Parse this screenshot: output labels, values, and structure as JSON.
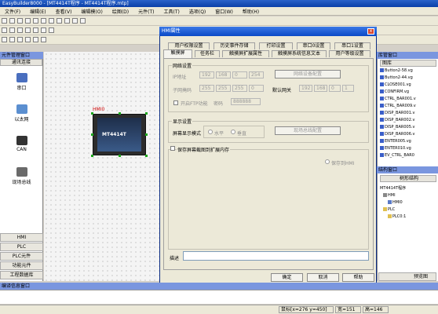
{
  "app": {
    "title": "EasyBuilder8000 - [MT4414T程序 - MT4414T程序.mtp]"
  },
  "menu": [
    "文件(F)",
    "编辑(E)",
    "查看(V)",
    "编辑模(O)",
    "绘图(D)",
    "元件(T)",
    "工具(T)",
    "选项(Q)",
    "窗口(W)",
    "帮助(H)"
  ],
  "left_panel": {
    "title": "元件管理窗口",
    "header": "通讯连接",
    "tools": [
      "串口",
      "以太网",
      "CAN",
      "现场总线"
    ],
    "bottom_items": [
      "HMI",
      "PLC",
      "PLC元件",
      "功能元件",
      "工程数据库"
    ]
  },
  "canvas": {
    "hmi_label": "HMI0",
    "hmi_model": "MT4414T"
  },
  "dialog": {
    "title": "HMI属性",
    "close": "x",
    "tabs_row1": [
      "用户权限设置",
      "历史事件存储",
      "打印设置",
      "串口0设置",
      "串口1设置"
    ],
    "tabs_row2": [
      "触摸屏",
      "任务栏",
      "触摸屏扩展属性",
      "触摸屏系统信息文本",
      "用户等级设置"
    ],
    "network": {
      "title": "网络设置",
      "ip_label": "IP地址",
      "ip": [
        "192",
        "168",
        "0",
        "254"
      ],
      "mask_label": "子网掩码",
      "mask": [
        "255",
        "255",
        "255",
        "0"
      ],
      "gateway_label": "默认网关",
      "gateway": [
        "192",
        "168",
        "0",
        "1"
      ],
      "config_button": "网络设备配置",
      "ftp_label": "开启FTP功能",
      "password_label": "密码",
      "password": "888888"
    },
    "display": {
      "title": "显示设置",
      "mode_label": "屏幕显示模式",
      "horizontal": "水平",
      "vertical": "垂直",
      "fieldbus_button": "现场总线配置"
    },
    "save": {
      "label": "保存屏幕截图到扩展内存",
      "to_hmi": "保存到HMI"
    },
    "description_label": "描述",
    "ok": "确定",
    "cancel": "取消",
    "help": "帮助"
  },
  "right_panel": {
    "library_title": "库管窗口",
    "library_header": "图库",
    "library_items": [
      "Button2-58.vg",
      "Button2-44.vg",
      "CLOSE001.vg",
      "CONFIRM.vg",
      "CTRL_BAR001.v",
      "CTRL_BAR009.v",
      "DISP_BAR001.v",
      "DISP_BAR002.v",
      "DISP_BAR005.v",
      "DISP_BAR006.v",
      "ENTER005.vg",
      "ENTER010.vg",
      "EV_CTRL_BAR0"
    ],
    "project_title": "结构窗口",
    "project_header": "树形结构",
    "project_root": "MT4414T程序",
    "tree": [
      "HMI",
      "HMI0",
      "PLC",
      "PLC0:1"
    ],
    "preview": "预览图"
  },
  "output": {
    "title": "编译信息窗口"
  },
  "status": {
    "coords": "鼠标[x=276  y=450]",
    "w": "宽=151",
    "h": "高=146"
  }
}
